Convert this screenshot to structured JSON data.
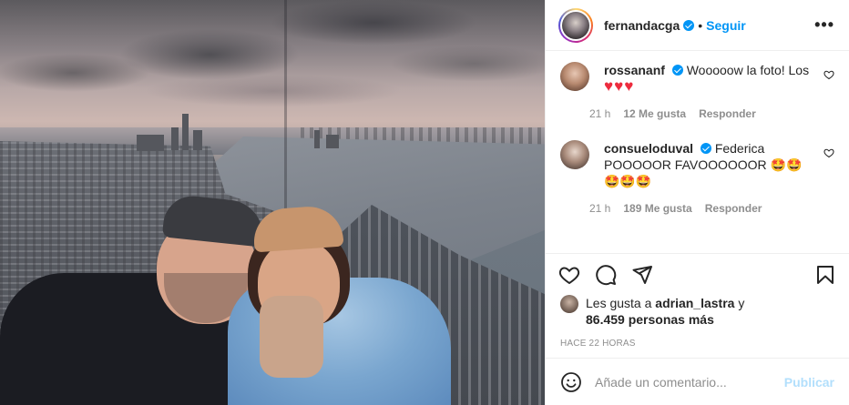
{
  "post": {
    "author": "fernandacga",
    "separator": "•",
    "follow_label": "Seguir",
    "more_label": "•••"
  },
  "comments": [
    {
      "username": "rossananf",
      "text": "Wooooow la foto! Los",
      "emoji": "♥♥♥",
      "time": "21 h",
      "likes": "12 Me gusta",
      "reply": "Responder"
    },
    {
      "username": "consueloduval",
      "text": "Federica POOOOOR FAVOOOOOOR",
      "emoji": "🤩🤩🤩🤩🤩",
      "time": "21 h",
      "likes": "189 Me gusta",
      "reply": "Responder"
    }
  ],
  "likes_summary": {
    "prefix": "Les gusta a",
    "user": "adrian_lastra",
    "conj": "y",
    "others": "86.459 personas más"
  },
  "timestamp": "HACE 22 HORAS",
  "add_comment": {
    "placeholder": "Añade un comentario...",
    "publish_label": "Publicar"
  },
  "icons": [
    "verified-icon",
    "more-icon",
    "heart-icon",
    "comment-icon",
    "share-icon",
    "bookmark-icon",
    "emoji-icon"
  ],
  "colors": {
    "accent": "#0095f6",
    "publish_disabled": "#b2dffc",
    "heart_red": "#ed2c3e",
    "muted": "#8e8e8e"
  }
}
